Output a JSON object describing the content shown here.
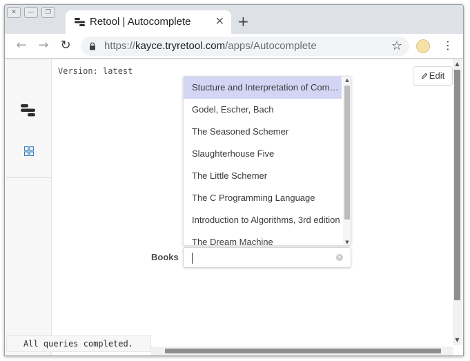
{
  "window_controls": [
    "✕",
    "—",
    "❐"
  ],
  "tab": {
    "title": "Retool | Autocomplete",
    "close": "✕",
    "new_tab": "+"
  },
  "nav": {
    "back": "←",
    "forward": "→",
    "reload": "↻"
  },
  "address": {
    "scheme": "https://",
    "host": "kayce.tryretool.com",
    "path": "/apps/Autocomplete"
  },
  "toolbar": {
    "bookmark": "☆",
    "menu": "⋮"
  },
  "icons": {
    "tab_favicon": "retool-logo-icon",
    "lock": "lock-icon",
    "sidebar_logo": "retool-logo-icon",
    "sidebar_grid": "grid-icon",
    "edit": "pencil-icon",
    "clear": "clear-icon"
  },
  "colors": {
    "accent": "#3b82c4",
    "highlight": "#d2d6f4",
    "logo": "#2d2d2d"
  },
  "page": {
    "version": "Version: latest",
    "edit_label": "Edit",
    "status": "All queries completed."
  },
  "form": {
    "label": "Books",
    "input_value": "",
    "clear": "×"
  },
  "dropdown": {
    "selected_index": 0,
    "items": [
      "Stucture and Interpretation of Computer Programs",
      "Godel, Escher, Bach",
      "The Seasoned Schemer",
      "Slaughterhouse Five",
      "The Little Schemer",
      "The C Programming Language",
      "Introduction to Algorithms, 3rd edition",
      "The Dream Machine"
    ]
  }
}
